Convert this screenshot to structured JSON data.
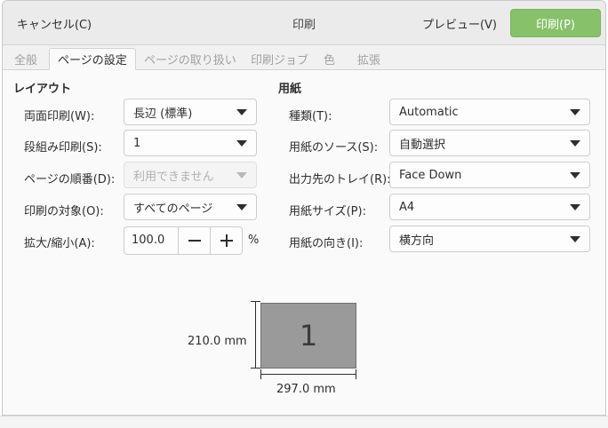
{
  "header": {
    "cancel_label": "キャンセル(C)",
    "title": "印刷",
    "preview_label": "プレビュー(V)",
    "print_label": "印刷(P)"
  },
  "tabs": [
    {
      "label": "全般",
      "active": false
    },
    {
      "label": "ページの設定",
      "active": true
    },
    {
      "label": "ページの取り扱い",
      "active": false
    },
    {
      "label": "印刷ジョブ",
      "active": false
    },
    {
      "label": "色",
      "active": false
    },
    {
      "label": "拡張",
      "active": false
    }
  ],
  "layout": {
    "title": "レイアウト",
    "duplex_label": "両面印刷(W):",
    "duplex_value": "長辺 (標準)",
    "nup_label": "段組み印刷(S):",
    "nup_value": "1",
    "order_label": "ページの順番(D):",
    "order_value": "利用できません",
    "target_label": "印刷の対象(O):",
    "target_value": "すべてのページ",
    "scale_label": "拡大/縮小(A):",
    "scale_value": "100.0",
    "scale_unit": "%"
  },
  "paper": {
    "title": "用紙",
    "type_label": "種類(T):",
    "type_value": "Automatic",
    "source_label": "用紙のソース(S):",
    "source_value": "自動選択",
    "tray_label": "出力先のトレイ(R):",
    "tray_value": "Face Down",
    "size_label": "用紙サイズ(P):",
    "size_value": "A4",
    "orientation_label": "用紙の向き(I):",
    "orientation_value": "横方向"
  },
  "preview": {
    "page_number": "1",
    "width_label": "297.0 mm",
    "height_label": "210.0 mm"
  },
  "colors": {
    "print_button": "#87c16a"
  }
}
